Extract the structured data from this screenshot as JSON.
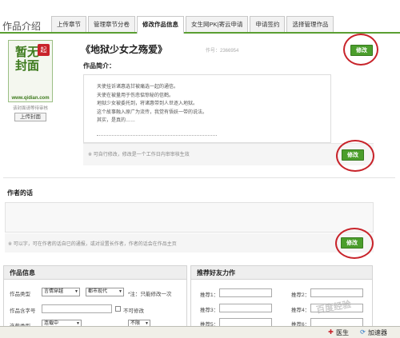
{
  "header": {
    "section_title": "作品介绍",
    "tabs": [
      {
        "label": "上传章节"
      },
      {
        "label": "管理章节分卷"
      },
      {
        "label": "修改作品信息",
        "active": true
      },
      {
        "label": "女生网PK|寄云申请"
      },
      {
        "label": "申请签约"
      },
      {
        "label": "选择管理作品"
      }
    ]
  },
  "cover": {
    "chars": "暂无封面",
    "seal": "起",
    "url": "www.qidian.com",
    "caption": "该封面请等待审核",
    "upload_label": "上传封面"
  },
  "book": {
    "title": "《地狱少女之殇爱》",
    "work_no": "作号：2366954",
    "edit_label": "修改"
  },
  "intro": {
    "label": "作品简介：",
    "lines": [
      "天使挂诉诸惠选甘被痛选一起的通信。",
      "天使在被量用于伤悲惦惊秘的信鹤。",
      "地狱少女被委托到，将诸惠带到人世逐入地狱。",
      "这个故事融入原广为流传，我觉有悟妖一带的说法。",
      "其实，是真的……"
    ],
    "note": "※ 可自行修改，修改是一个工作日内审审核生效",
    "edit_label": "修改"
  },
  "author_words": {
    "label": "作者的话",
    "note": "※ 可以字，可在作者的话自已的通报，或对设置长作者，作者的话会在作品主页",
    "edit_label": "修改"
  },
  "work_info": {
    "title": "作品信息",
    "type_label": "作品类型",
    "type_value": "言情穿越",
    "subtype_value": "都市现代",
    "type_note": "*注：只能修改一次",
    "keyword_label": "作品含字号",
    "keyword_note": "不可修改",
    "status_label": "连载类型",
    "status_value": "连载中",
    "extra_value": "不限"
  },
  "recommend": {
    "title": "推荐好友力作",
    "label1": "推荐1：",
    "label2": "推荐2：",
    "label3": "推荐3：",
    "label4": "推荐4：",
    "label5": "推荐5：",
    "label6": "推荐6："
  },
  "taskbar": {
    "item1": "医生",
    "item2": "加速器"
  },
  "watermark": "百度经验",
  "colors": {
    "accent_green": "#4b9e2c",
    "annotation_red": "#c8232a"
  }
}
